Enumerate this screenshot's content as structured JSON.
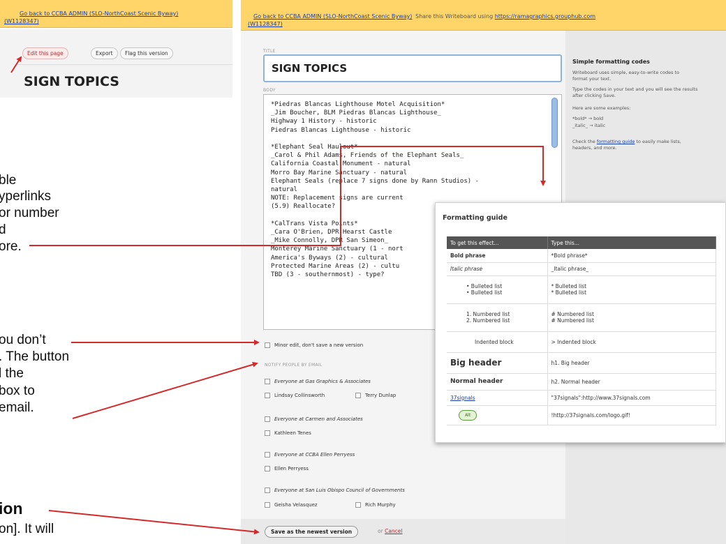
{
  "left_shot": {
    "back_link_line1": "Go back to CCBA ADMIN (SLO-NorthCoast Scenic Byway)",
    "back_link_line2": "(W1128347)",
    "edit_button": "Edit this page",
    "export_button": "Export",
    "flag_button": "Flag this version",
    "page_title": "SIGN TOPICS"
  },
  "header": {
    "back_link_line1": "Go back to CCBA ADMIN (SLO-NorthCoast Scenic Byway)",
    "back_link_line2": "(W1128347)",
    "share_text": "Share this Writeboard using",
    "share_link": "https://ramagraphics.grouphub.com"
  },
  "editor": {
    "title_label": "TITLE",
    "title_value": "SIGN TOPICS",
    "body_label": "BODY",
    "body_lines": [
      "*Piedras Blancas Lighthouse Motel Acquisition*",
      "_Jim Boucher, BLM Piedras Blancas Lighthouse_",
      "Highway 1 History - historic",
      "Piedras Blancas Lighthouse - historic",
      "",
      "*Elephant Seal Haulout*",
      "_Carol & Phil Adams, Friends of the Elephant Seals_",
      "California Coastal Monument - natural",
      "Morro Bay Marine Sanctuary - natural",
      "Elephant Seals (replace 7 signs done by Rann Studios) -",
      "natural",
      "NOTE: Replacement signs are current",
      "(5.9) Reallocate?",
      "",
      "*CalTrans Vista Points*",
      "_Cara O'Brien, DPR Hearst Castle",
      "_Mike Connolly, DPR San Simeon_",
      "Monterey Marine Sanctuary (1 - nort",
      "America's Byways (2) - cultural",
      "Protected Marine Areas (2) - cultu",
      "TBD (3 - southernmost) - type?"
    ],
    "minor_edit_label": "Minor edit, don't save a new version",
    "notify_label": "NOTIFY PEOPLE BY EMAIL",
    "groups": [
      {
        "label": "Everyone at Gas Graphics & Associates",
        "people": [
          "Lindsay Collinsworth",
          "Terry Dunlap"
        ]
      },
      {
        "label": "Everyone at Carmen and Associates",
        "people": [
          "Kathleen Tenes"
        ]
      },
      {
        "label": "Everyone at CCBA Ellen Perryess",
        "people": [
          "Ellen Perryess"
        ]
      },
      {
        "label": "Everyone at San Luis Obispo Council of Governments",
        "people": [
          "Geisha Velasquez",
          "Rich Murphy"
        ]
      }
    ],
    "save_button": "Save as the newest version",
    "or_text": "or",
    "cancel_link": "Cancel"
  },
  "sidebar": {
    "heading": "Simple formatting codes",
    "p1": "Writeboard uses simple, easy-to-write codes to format your text.",
    "p2": "Type the codes in your text and you will see the results after clicking Save.",
    "p3": "Here are some examples:",
    "ex1": "*bold* → bold",
    "ex2": "_italic_ → italic",
    "p4_prefix": "Check the",
    "p4_link": "formatting guide",
    "p4_suffix": "to easily make lists, headers, and more."
  },
  "guide": {
    "title": "Formatting guide",
    "col1": "To get this effect...",
    "col2": "Type this...",
    "rows": [
      {
        "effect": "Bold phrase",
        "code": "*Bold phrase*"
      },
      {
        "effect": "Italic phrase",
        "code": "_Italic phrase_"
      },
      {
        "effect": "• Bulleted list\n• Bulleted list",
        "code": "* Bulleted list\n* Bulleted list"
      },
      {
        "effect": "1. Numbered list\n2. Numbered list",
        "code": "# Numbered list\n# Numbered list"
      },
      {
        "effect": "Indented block",
        "code": "> Indented block"
      },
      {
        "effect": "Big header",
        "code": "h1. Big header"
      },
      {
        "effect": "Normal header",
        "code": "h2. Normal header"
      },
      {
        "effect": "37signals",
        "code": "\"37signals\":http://www.37signals.com"
      },
      {
        "effect": "Alt",
        "code": "!http://37signals.com/logo.gif!"
      }
    ]
  },
  "annotations": {
    "a1": "ble",
    "a2": "yperlinks",
    "a3": "or number",
    "a4": "d",
    "a5": "ore.",
    "b1": "ou don’t",
    "b2": ". The button",
    "b3": "l the",
    "b4": "box to",
    "b5": "email.",
    "c1": "ion",
    "c2": "on]. It will"
  },
  "colors": {
    "annotation_arrow": "#d42a2a",
    "header_bar": "#ffd56a",
    "link": "#1a3fa3"
  }
}
